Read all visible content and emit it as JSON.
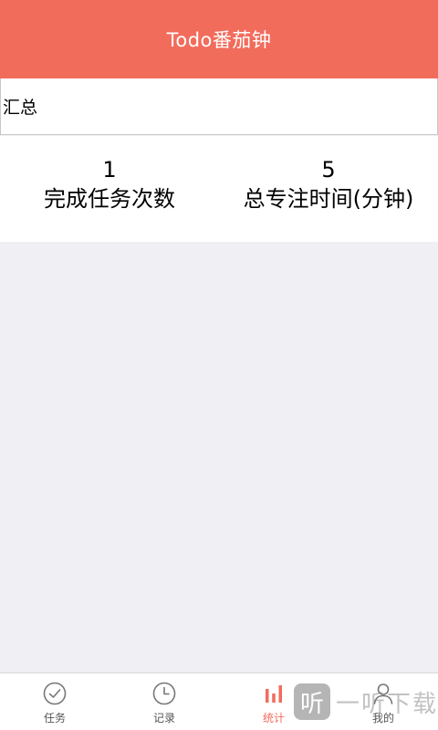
{
  "header": {
    "title": "Todo番茄钟"
  },
  "summary": {
    "title": "汇总"
  },
  "stats": [
    {
      "value": "1",
      "label": "完成任务次数"
    },
    {
      "value": "5",
      "label": "总专注时间(分钟)"
    }
  ],
  "tabs": [
    {
      "label": "任务",
      "icon": "check-circle-icon",
      "active": false
    },
    {
      "label": "记录",
      "icon": "clock-icon",
      "active": false
    },
    {
      "label": "统计",
      "icon": "bar-chart-icon",
      "active": true
    },
    {
      "label": "我的",
      "icon": "user-icon",
      "active": false
    }
  ],
  "watermark": {
    "logo_char": "听",
    "text": "一听下载"
  },
  "colors": {
    "accent": "#f26c5c",
    "background": "#efeff4",
    "inactive_icon": "#777777"
  }
}
